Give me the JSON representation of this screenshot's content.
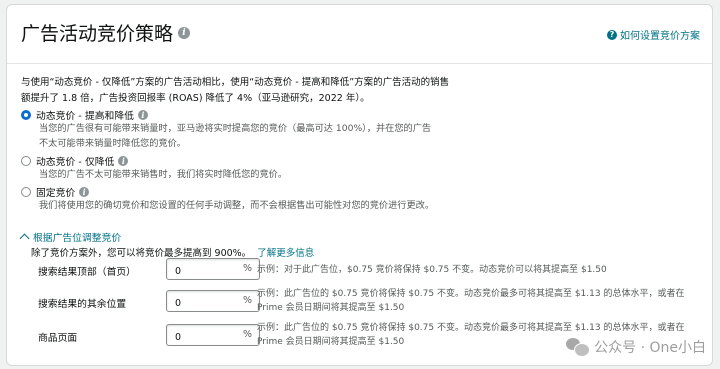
{
  "header": {
    "title": "广告活动竞价策略",
    "help_link": "如何设置竞价方案"
  },
  "intro": {
    "line1": "与使用“动态竞价 - 仅降低”方案的广告活动相比，使用“动态竞价 - 提高和降低”方案的广告活动的销售",
    "line2": "额提升了 1.8 倍，广告投资回报率 (ROAS) 降低了 4%（亚马逊研究，2022 年）。"
  },
  "options": [
    {
      "label": "动态竞价 - 提高和降低",
      "checked": true,
      "desc1": "当您的广告很有可能带来销量时，亚马逊将实时提高您的竞价（最高可达 100%），并在您的广告",
      "desc2": "不太可能带来销量时降低您的竞价。"
    },
    {
      "label": "动态竞价 - 仅降低",
      "checked": false,
      "desc1": "当您的广告不太可能带来销售时，我们将实时降低您的竞价。"
    },
    {
      "label": "固定竞价",
      "checked": false,
      "desc1": "我们将使用您的确切竞价和您设置的任何手动调整，而不会根据售出可能性对您的竞价进行更改。"
    }
  ],
  "adjust": {
    "toggle_label": "根据广告位调整竞价",
    "note": "除了竞价方案外，您可以将竞价最多提高到 900%。",
    "learn_more": "了解更多信息",
    "rows": [
      {
        "label": "搜索结果顶部（首页）",
        "value": "0",
        "unit": "%",
        "example1": "示例：对于此广告位，$0.75 竞价将保持 $0.75 不变。动态竞价可以将其提高至 $1.50",
        "example2": ""
      },
      {
        "label": "搜索结果的其余位置",
        "value": "0",
        "unit": "%",
        "example1": "示例：此广告位的 $0.75 竞价将保持 $0.75 不变。动态竞价最多可将其提高至 $1.13 的总体水平，或者在",
        "example2": "Prime 会员日期间将其提高至 $1.50"
      },
      {
        "label": "商品页面",
        "value": "0",
        "unit": "%",
        "example1": "示例：此广告位的 $0.75 竞价将保持 $0.75 不变。动态竞价最多可将其提高至 $1.13 的总体水平，或者在",
        "example2": "Prime 会员日期间将其提高至 $1.50"
      }
    ]
  },
  "watermark": "公众号 · One小白",
  "colors": {
    "accent": "#007185",
    "radio_checked": "#0a6ed1"
  }
}
